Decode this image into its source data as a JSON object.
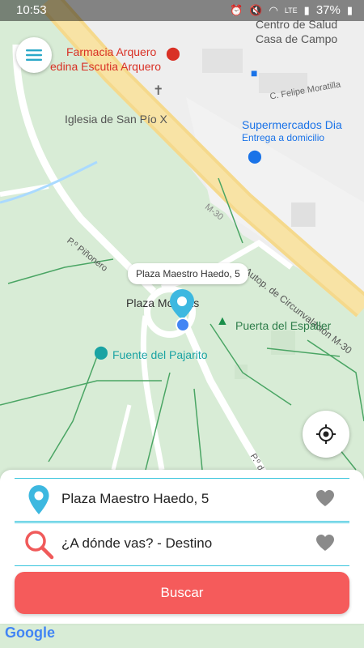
{
  "status_bar": {
    "time": "10:53",
    "icons": [
      "alarm-icon",
      "mute-icon",
      "wifi-icon",
      "volte-icon",
      "signal-icon"
    ],
    "battery": "37%"
  },
  "map": {
    "labels": {
      "farmacia_line1": "Farmacia Arquero",
      "farmacia_line2": "edina Escutia Arquero",
      "centro_salud_line1": "Centro de Salud",
      "centro_salud_line2": "Casa de Campo",
      "iglesia": "Iglesia de San Pío X",
      "felipe": "C. Felipe Moratilla",
      "supermercado": "Supermercados Dia",
      "supermercado_sub": "Entrega a domicilio",
      "m30": "M-30",
      "autopista": "Autop. de Circunvalación M-30",
      "pinonero": "P.º Piñonero",
      "plaza": "Plaza Moreras",
      "puerta": "Puerta del Espaller",
      "fuente": "Fuente del Pajarito",
      "paseo_bottom": "P.º de"
    },
    "callout": "Plaza Maestro Haedo, 5"
  },
  "panel": {
    "origin": "Plaza Maestro Haedo, 5",
    "destination_placeholder": "¿A dónde vas? - Destino",
    "search_label": "Buscar"
  },
  "colors": {
    "accent": "#39c5dd",
    "search_button": "#f55b5b",
    "pin": "#3db8e0"
  },
  "attribution": "Google"
}
